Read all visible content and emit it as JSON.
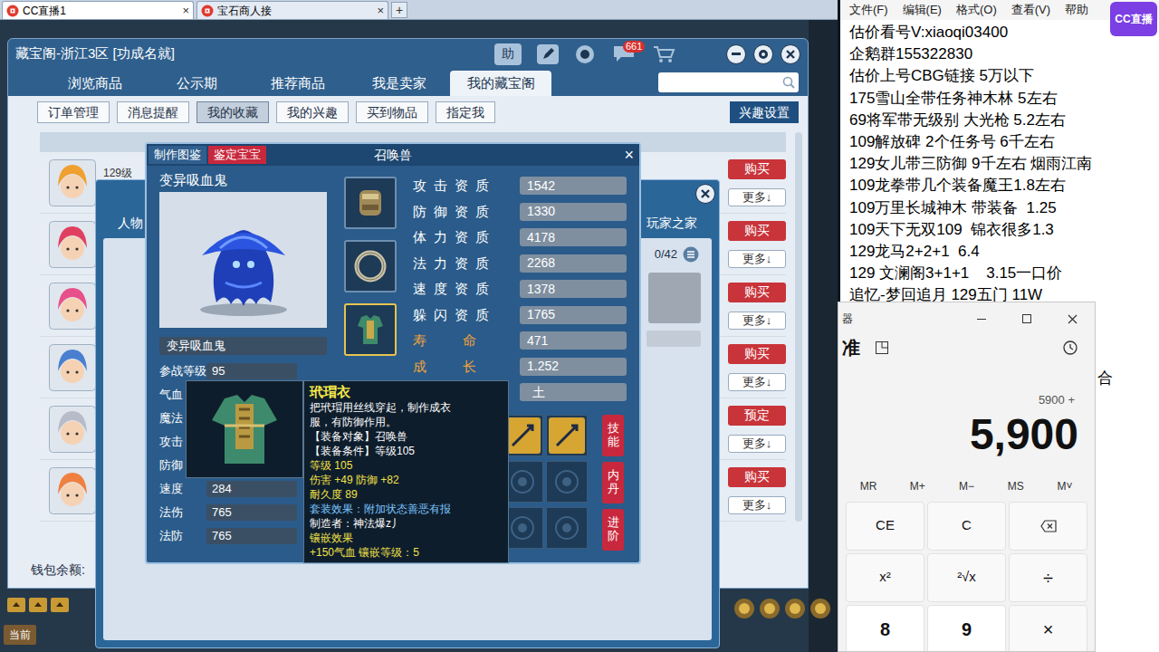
{
  "browser": {
    "tabs": [
      {
        "label": "CC直播1",
        "close": "×",
        "selected": true
      },
      {
        "label": "宝石商人接",
        "close": "×",
        "selected": false
      }
    ],
    "new_tab": "+"
  },
  "cbg": {
    "title": "藏宝阁-浙江3区 [功成名就]",
    "help": "助",
    "badge": "661",
    "tabs": [
      {
        "label": "浏览商品",
        "selected": false
      },
      {
        "label": "公示期",
        "selected": false
      },
      {
        "label": "推荐商品",
        "selected": false
      },
      {
        "label": "我是卖家",
        "selected": false
      },
      {
        "label": "我的藏宝阁",
        "selected": true
      }
    ],
    "subtabs": [
      {
        "label": "订单管理",
        "selected": false
      },
      {
        "label": "消息提醒",
        "selected": false
      },
      {
        "label": "我的收藏",
        "selected": true
      },
      {
        "label": "我的兴趣",
        "selected": false
      },
      {
        "label": "买到物品",
        "selected": false
      },
      {
        "label": "指定我",
        "selected": false
      }
    ],
    "interest_settings": "兴趣设置",
    "first_item_level": "129级",
    "rows": [
      {
        "action": "购买",
        "more": "更多↓"
      },
      {
        "action": "购买",
        "more": "更多↓"
      },
      {
        "action": "购买",
        "more": "更多↓"
      },
      {
        "action": "购买",
        "more": "更多↓"
      },
      {
        "action": "预定",
        "more": "更多↓"
      },
      {
        "action": "购买",
        "more": "更多↓"
      }
    ],
    "wallet_label": "钱包余额:"
  },
  "middle_dialog": {
    "tabs": [
      "人物",
      "玩家之家"
    ],
    "count": "0/42"
  },
  "pet": {
    "tabs": [
      {
        "label": "制作图鉴",
        "kind": "plain"
      },
      {
        "label": "鉴定宝宝",
        "kind": "alert"
      }
    ],
    "title": "召唤兽",
    "close": "×",
    "species": "变异吸血鬼",
    "name": "变异吸血鬼",
    "stats": [
      {
        "label": "参战等级",
        "value": "95"
      },
      {
        "label": "气血"
      },
      {
        "label": "魔法"
      },
      {
        "label": "攻击"
      },
      {
        "label": "防御"
      },
      {
        "label": "速度",
        "value": "284"
      },
      {
        "label": "法伤",
        "value": "765"
      },
      {
        "label": "法防",
        "value": "765"
      }
    ],
    "aptitudes": [
      {
        "label": "攻击资质",
        "value": "1542",
        "kind": "normal"
      },
      {
        "label": "防御资质",
        "value": "1330",
        "kind": "normal"
      },
      {
        "label": "体力资质",
        "value": "4178",
        "kind": "normal"
      },
      {
        "label": "法力资质",
        "value": "2268",
        "kind": "normal"
      },
      {
        "label": "速度资质",
        "value": "1378",
        "kind": "normal"
      },
      {
        "label": "躲闪资质",
        "value": "1765",
        "kind": "normal"
      },
      {
        "label": "寿命",
        "value": "471",
        "kind": "highlight"
      },
      {
        "label": "成长",
        "value": "1.252",
        "kind": "highlight"
      }
    ],
    "element": "土",
    "side_buttons": [
      "技能",
      "内丹",
      "进阶"
    ]
  },
  "tooltip": {
    "name": "玳瑁衣",
    "description": "把玳瑁用丝线穿起，制作成衣服，有防御作用。",
    "lines": [
      {
        "text": "【装备对象】召唤兽",
        "kind": "plain"
      },
      {
        "text": "【装备条件】等级105",
        "kind": "plain"
      },
      {
        "text": "等级 105",
        "kind": "stat"
      },
      {
        "text": "伤害 +49 防御 +82",
        "kind": "stat"
      },
      {
        "text": "耐久度 89",
        "kind": "stat"
      },
      {
        "text": "套装效果：附加状态善恶有报",
        "kind": "set"
      },
      {
        "text": "制造者：神法爆z丿",
        "kind": "plain"
      },
      {
        "text": "镶嵌效果",
        "kind": "stat"
      },
      {
        "text": "+150气血 镶嵌等级：5",
        "kind": "stat"
      }
    ]
  },
  "notepad": {
    "menu": [
      "文件(F)",
      "编辑(E)",
      "格式(O)",
      "查看(V)",
      "帮助"
    ],
    "lines": [
      "估价看号V:xiaoqi03400",
      "企鹅群155322830",
      "估价上号CBG链接 5万以下",
      "175雪山全带任务神木林 5左右",
      "69将军带无级别 大光枪 5.2左右",
      "109解放碑 2个任务号 6千左右",
      "129女儿带三防御 9千左右 烟雨江南",
      "109龙拳带几个装备魔王1.8左右",
      "109万里长城神木 带装备  1.25",
      "109天下无双109  锦衣很多1.3",
      "129龙马2+2+1  6.4",
      "129 文澜阁3+1+1    3.15一口价",
      "追忆-梦回追月 129五门 11W"
    ],
    "hidden_tail": "合"
  },
  "calculator": {
    "title": "器",
    "mode": "准",
    "expression": "5900 +",
    "display": "5,900",
    "memory": [
      "MR",
      "M+",
      "M−",
      "MS",
      "M˅"
    ],
    "keys": [
      {
        "label": "CE",
        "kind": "fn"
      },
      {
        "label": "C",
        "kind": "fn"
      },
      {
        "kind": "backspace"
      },
      {
        "label": "x²",
        "kind": "fn"
      },
      {
        "label": "²√x",
        "kind": "fn"
      },
      {
        "label": "÷",
        "kind": "op"
      },
      {
        "label": "8",
        "kind": "digit"
      },
      {
        "label": "9",
        "kind": "digit"
      },
      {
        "label": "×",
        "kind": "op"
      }
    ]
  },
  "logo": "CC直播",
  "chat_channel": "当前"
}
